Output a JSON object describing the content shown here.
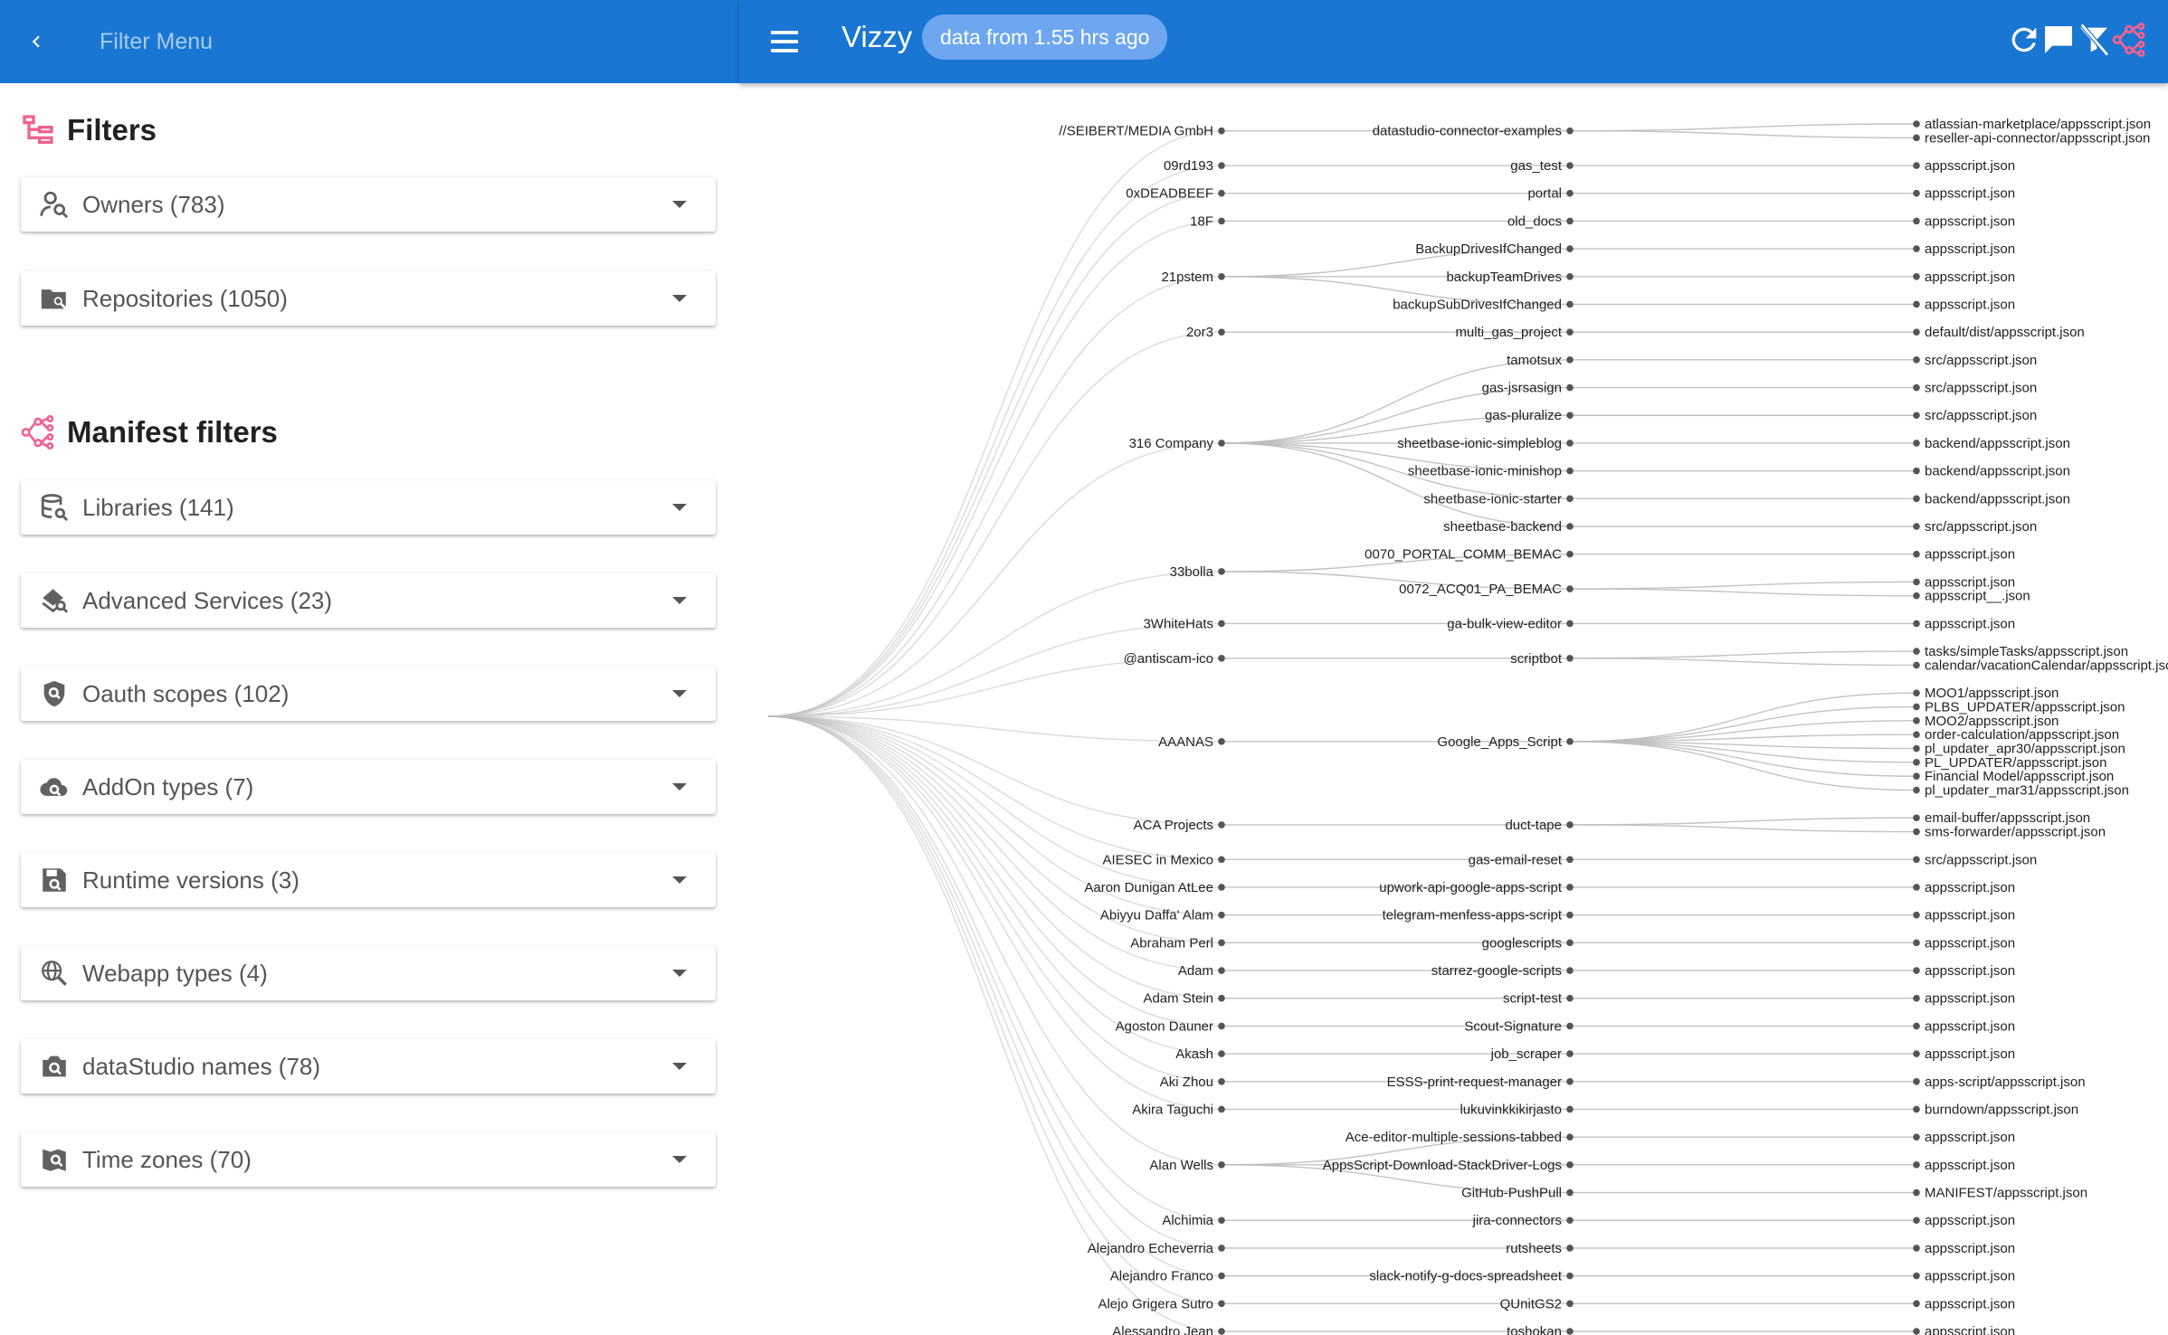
{
  "filter_menu": {
    "title": "Filter Menu",
    "back_icon": "chevron-left-icon"
  },
  "filters_section": {
    "title": "Filters",
    "items": [
      {
        "label": "Owners (783)",
        "icon": "person-search-icon"
      },
      {
        "label": "Repositories (1050)",
        "icon": "folder-search-icon"
      }
    ]
  },
  "manifest_section": {
    "title": "Manifest filters",
    "items": [
      {
        "label": "Libraries (141)",
        "icon": "database-search-icon"
      },
      {
        "label": "Advanced Services (23)",
        "icon": "service-search-icon"
      },
      {
        "label": "Oauth scopes (102)",
        "icon": "shield-search-icon"
      },
      {
        "label": "AddOn types (7)",
        "icon": "cloud-search-icon"
      },
      {
        "label": "Runtime versions (3)",
        "icon": "floppy-search-icon"
      },
      {
        "label": "Webapp types (4)",
        "icon": "globe-search-icon"
      },
      {
        "label": "dataStudio names (78)",
        "icon": "camera-search-icon"
      },
      {
        "label": "Time zones (70)",
        "icon": "map-search-icon"
      }
    ]
  },
  "topbar": {
    "app_title": "Vizzy",
    "badge": "data from 1.55 hrs ago",
    "menu_icon": "hamburger-menu-icon",
    "icons": [
      "refresh-icon",
      "comment-icon",
      "filter-off-icon",
      "graph-icon"
    ]
  },
  "colors": {
    "primary": "#1976d2",
    "badge": "#6ea6f0",
    "accent": "#f06292",
    "link": "#bdbdbd"
  },
  "graph": {
    "owners": [
      {
        "name": "//SEIBERT/MEDIA GmbH",
        "repos": [
          {
            "name": "datastudio-connector-examples",
            "manifests": [
              "atlassian-marketplace/appsscript.json",
              "reseller-api-connector/appsscript.json"
            ]
          }
        ]
      },
      {
        "name": "09rd193",
        "repos": [
          {
            "name": "gas_test",
            "manifests": [
              "appsscript.json"
            ]
          }
        ]
      },
      {
        "name": "0xDEADBEEF",
        "repos": [
          {
            "name": "portal",
            "manifests": [
              "appsscript.json"
            ]
          }
        ]
      },
      {
        "name": "18F",
        "repos": [
          {
            "name": "old_docs",
            "manifests": [
              "appsscript.json"
            ]
          }
        ]
      },
      {
        "name": "21pstem",
        "repos": [
          {
            "name": "BackupDrivesIfChanged",
            "manifests": [
              "appsscript.json"
            ]
          },
          {
            "name": "backupTeamDrives",
            "manifests": [
              "appsscript.json"
            ]
          },
          {
            "name": "backupSubDrivesIfChanged",
            "manifests": [
              "appsscript.json"
            ]
          }
        ]
      },
      {
        "name": "2or3",
        "repos": [
          {
            "name": "multi_gas_project",
            "manifests": [
              "default/dist/appsscript.json"
            ]
          }
        ]
      },
      {
        "name": "316 Company",
        "repos": [
          {
            "name": "tamotsux",
            "manifests": [
              "src/appsscript.json"
            ]
          },
          {
            "name": "gas-jsrsasign",
            "manifests": [
              "src/appsscript.json"
            ]
          },
          {
            "name": "gas-pluralize",
            "manifests": [
              "src/appsscript.json"
            ]
          },
          {
            "name": "sheetbase-ionic-simpleblog",
            "manifests": [
              "backend/appsscript.json"
            ]
          },
          {
            "name": "sheetbase-ionic-minishop",
            "manifests": [
              "backend/appsscript.json"
            ]
          },
          {
            "name": "sheetbase-ionic-starter",
            "manifests": [
              "backend/appsscript.json"
            ]
          },
          {
            "name": "sheetbase-backend",
            "manifests": [
              "src/appsscript.json"
            ]
          }
        ]
      },
      {
        "name": "33bolla",
        "repos": [
          {
            "name": "0070_PORTAL_COMM_BEMAC",
            "manifests": [
              "appsscript.json"
            ]
          },
          {
            "name": "0072_ACQ01_PA_BEMAC",
            "manifests": [
              "appsscript.json",
              "appsscript__.json"
            ]
          }
        ]
      },
      {
        "name": "3WhiteHats",
        "repos": [
          {
            "name": "ga-bulk-view-editor",
            "manifests": [
              "appsscript.json"
            ]
          }
        ]
      },
      {
        "name": "@antiscam-ico",
        "repos": [
          {
            "name": "scriptbot",
            "manifests": [
              "tasks/simpleTasks/appsscript.json",
              "calendar/vacationCalendar/appsscript.json"
            ]
          }
        ]
      },
      {
        "name": "AAANAS",
        "repos": [
          {
            "name": "Google_Apps_Script",
            "manifests": [
              "MOO1/appsscript.json",
              "PLBS_UPDATER/appsscript.json",
              "MOO2/appsscript.json",
              "order-calculation/appsscript.json",
              "pl_updater_apr30/appsscript.json",
              "PL_UPDATER/appsscript.json",
              "Financial Model/appsscript.json",
              "pl_updater_mar31/appsscript.json"
            ]
          }
        ]
      },
      {
        "name": "ACA Projects",
        "repos": [
          {
            "name": "duct-tape",
            "manifests": [
              "email-buffer/appsscript.json",
              "sms-forwarder/appsscript.json"
            ]
          }
        ]
      },
      {
        "name": "AIESEC in Mexico",
        "repos": [
          {
            "name": "gas-email-reset",
            "manifests": [
              "src/appsscript.json"
            ]
          }
        ]
      },
      {
        "name": "Aaron Dunigan AtLee",
        "repos": [
          {
            "name": "upwork-api-google-apps-script",
            "manifests": [
              "appsscript.json"
            ]
          }
        ]
      },
      {
        "name": "Abiyyu Daffa' Alam",
        "repos": [
          {
            "name": "telegram-menfess-apps-script",
            "manifests": [
              "appsscript.json"
            ]
          }
        ]
      },
      {
        "name": "Abraham Perl",
        "repos": [
          {
            "name": "googlescripts",
            "manifests": [
              "appsscript.json"
            ]
          }
        ]
      },
      {
        "name": "Adam",
        "repos": [
          {
            "name": "starrez-google-scripts",
            "manifests": [
              "appsscript.json"
            ]
          }
        ]
      },
      {
        "name": "Adam Stein",
        "repos": [
          {
            "name": "script-test",
            "manifests": [
              "appsscript.json"
            ]
          }
        ]
      },
      {
        "name": "Agoston Dauner",
        "repos": [
          {
            "name": "Scout-Signature",
            "manifests": [
              "appsscript.json"
            ]
          }
        ]
      },
      {
        "name": "Akash",
        "repos": [
          {
            "name": "job_scraper",
            "manifests": [
              "appsscript.json"
            ]
          }
        ]
      },
      {
        "name": "Aki Zhou",
        "repos": [
          {
            "name": "ESSS-print-request-manager",
            "manifests": [
              "apps-script/appsscript.json"
            ]
          }
        ]
      },
      {
        "name": "Akira Taguchi",
        "repos": [
          {
            "name": "lukuvinkkikirjasto",
            "manifests": [
              "burndown/appsscript.json"
            ]
          }
        ]
      },
      {
        "name": "Alan Wells",
        "repos": [
          {
            "name": "Ace-editor-multiple-sessions-tabbed",
            "manifests": [
              "appsscript.json"
            ]
          },
          {
            "name": "AppsScript-Download-StackDriver-Logs",
            "manifests": [
              "appsscript.json"
            ]
          },
          {
            "name": "GitHub-PushPull",
            "manifests": [
              "MANIFEST/appsscript.json"
            ]
          }
        ]
      },
      {
        "name": "Alchimia",
        "repos": [
          {
            "name": "jira-connectors",
            "manifests": [
              "appsscript.json"
            ]
          }
        ]
      },
      {
        "name": "Alejandro Echeverria",
        "repos": [
          {
            "name": "rutsheets",
            "manifests": [
              "appsscript.json"
            ]
          }
        ]
      },
      {
        "name": "Alejandro Franco",
        "repos": [
          {
            "name": "slack-notify-g-docs-spreadsheet",
            "manifests": [
              "appsscript.json"
            ]
          }
        ]
      },
      {
        "name": "Alejo Grigera Sutro",
        "repos": [
          {
            "name": "QUnitGS2",
            "manifests": [
              "appsscript.json"
            ]
          }
        ]
      },
      {
        "name": "Alessandro Jean",
        "repos": [
          {
            "name": "toshokan",
            "manifests": [
              "appsscript.json"
            ]
          }
        ]
      }
    ]
  }
}
